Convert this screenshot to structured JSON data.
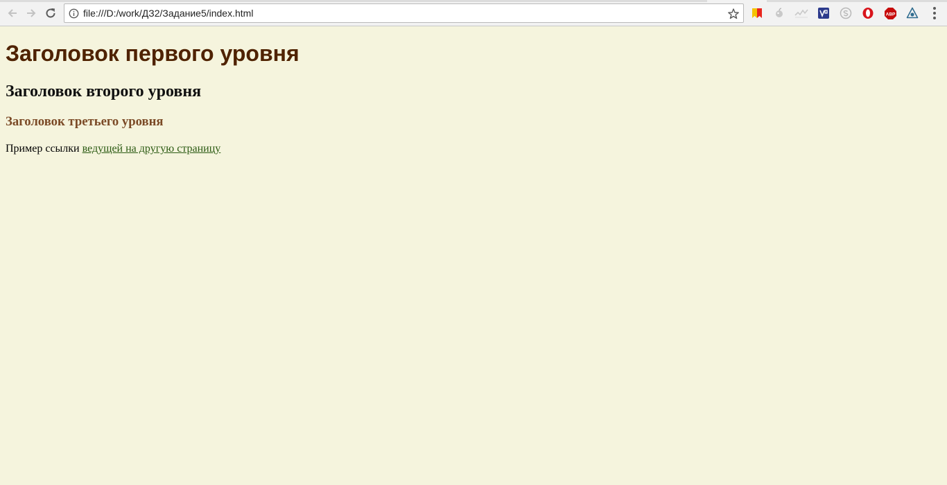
{
  "browser": {
    "url": "file:///D:/work/ДЗ2/Задание5/index.html",
    "extensions": [
      "yandex-bookmark-icon",
      "apple-icon",
      "wave-icon",
      "vpn-icon",
      "skype-icon",
      "opera-icon",
      "adblock-plus-icon",
      "eye-icon"
    ],
    "adblock_label": "ABP"
  },
  "page": {
    "h1": "Заголовок первого уровня",
    "h2": "Заголовок второго уровня",
    "h3": "Заголовок третьего уровня",
    "paragraph_prefix": "Пример ссылки ",
    "link_text": "ведущей на другую страницу"
  },
  "colors": {
    "page_background": "#f5f4dd",
    "h1": "#4f2200",
    "h2": "#111111",
    "h3": "#7b4a26",
    "link": "#2b5a12"
  }
}
